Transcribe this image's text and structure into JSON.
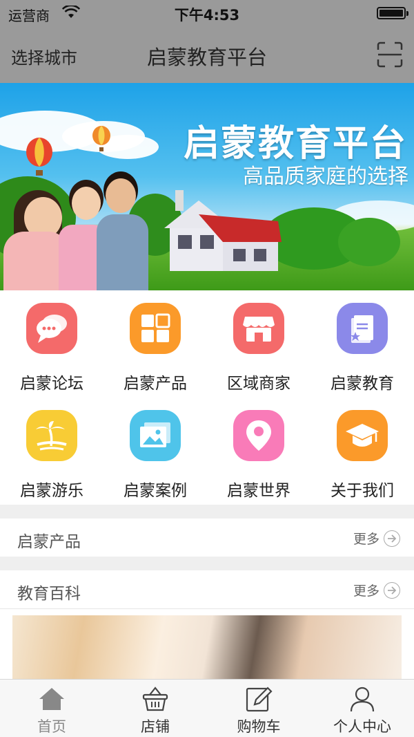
{
  "status_bar": {
    "carrier": "运营商",
    "time": "下午4:53"
  },
  "nav": {
    "city_label": "选择城市",
    "title": "启蒙教育平台"
  },
  "banner": {
    "title": "启蒙教育平台",
    "subtitle": "高品质家庭的选择"
  },
  "grid": [
    {
      "label": "启蒙论坛",
      "icon": "chat-bubbles-icon",
      "color": "#f46a6a"
    },
    {
      "label": "启蒙产品",
      "icon": "grid-squares-icon",
      "color": "#fb9a2a"
    },
    {
      "label": "区域商家",
      "icon": "store-icon",
      "color": "#f46a6a"
    },
    {
      "label": "启蒙教育",
      "icon": "book-star-icon",
      "color": "#8b89e9"
    },
    {
      "label": "启蒙游乐",
      "icon": "palm-island-icon",
      "color": "#f8cc35"
    },
    {
      "label": "启蒙案例",
      "icon": "picture-icon",
      "color": "#4fc4ea"
    },
    {
      "label": "启蒙世界",
      "icon": "location-pin-icon",
      "color": "#f97bb8"
    },
    {
      "label": "关于我们",
      "icon": "graduation-cap-icon",
      "color": "#fb9a2a"
    }
  ],
  "sections": [
    {
      "title": "启蒙产品",
      "more": "更多"
    },
    {
      "title": "教育百科",
      "more": "更多"
    }
  ],
  "tabbar": [
    {
      "label": "首页",
      "icon": "home-icon",
      "active": true
    },
    {
      "label": "店铺",
      "icon": "basket-icon"
    },
    {
      "label": "购物车",
      "icon": "edit-icon"
    },
    {
      "label": "个人中心",
      "icon": "person-icon"
    }
  ]
}
